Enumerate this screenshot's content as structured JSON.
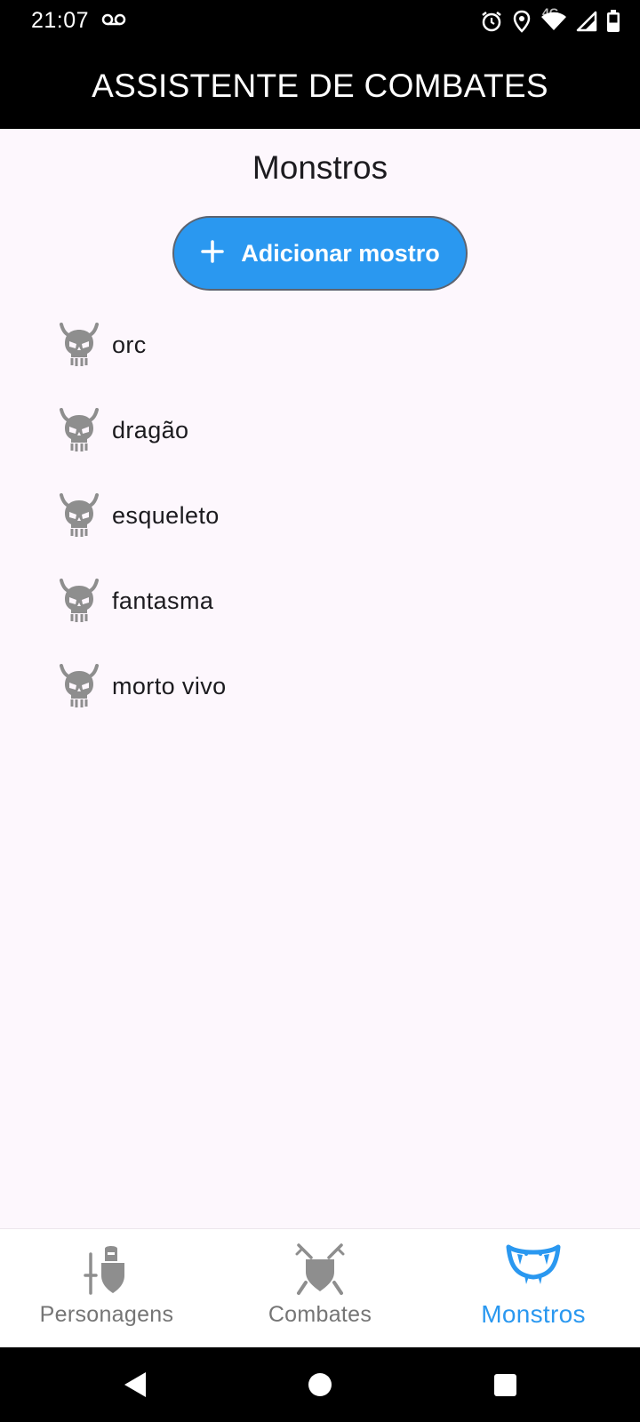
{
  "status_bar": {
    "time": "21:07",
    "network": "4G",
    "icons": [
      "voicemail-icon",
      "alarm-icon",
      "location-icon",
      "wifi-icon",
      "signal-icon",
      "battery-icon"
    ]
  },
  "app_bar": {
    "title": "ASSISTENTE DE COMBATES"
  },
  "page": {
    "title": "Monstros",
    "add_button": {
      "icon": "plus-icon",
      "label": "Adicionar mostro"
    }
  },
  "monsters": [
    {
      "name": "orc",
      "icon": "demon-skull-icon"
    },
    {
      "name": "dragão",
      "icon": "demon-skull-icon"
    },
    {
      "name": "esqueleto",
      "icon": "demon-skull-icon"
    },
    {
      "name": "fantasma",
      "icon": "demon-skull-icon"
    },
    {
      "name": "morto vivo",
      "icon": "demon-skull-icon"
    }
  ],
  "bottom_nav": {
    "items": [
      {
        "label": "Personagens",
        "icon": "knight-icon",
        "active": false
      },
      {
        "label": "Combates",
        "icon": "crossed-swords-shield-icon",
        "active": false
      },
      {
        "label": "Monstros",
        "icon": "fangs-icon",
        "active": true
      }
    ]
  },
  "colors": {
    "accent": "#2a98f0",
    "app_bar": "#000000",
    "background": "#fdf7fd",
    "inactive": "#757575",
    "icon_gray": "#8e8e8e"
  }
}
